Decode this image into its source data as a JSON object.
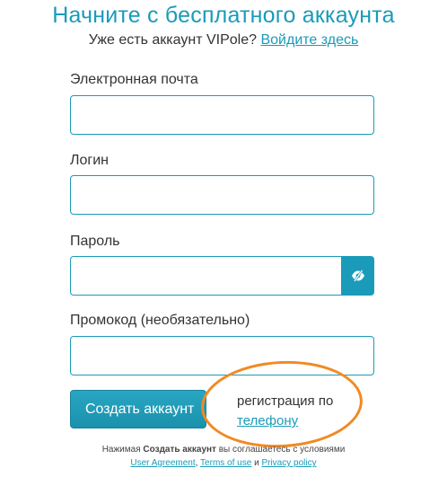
{
  "header": {
    "title": "Начните с бесплатного аккаунта",
    "login_prompt": "Уже есть аккаунт VIPole?",
    "login_link": "Войдите здесь"
  },
  "form": {
    "email_label": "Электронная почта",
    "email_value": "",
    "login_label": "Логин",
    "login_value": "",
    "password_label": "Пароль",
    "password_value": "",
    "promo_label": "Промокод (необязательно)",
    "promo_value": "",
    "create_button": "Создать аккаунт",
    "phone_text": "регистрация по",
    "phone_link": "телефону"
  },
  "legal": {
    "prefix": "Нажимая",
    "button_name": "Создать аккаунт",
    "suffix": "вы соглашаетесь с условиями",
    "user_agreement": "User Agreement",
    "comma": ",",
    "terms": "Terms of use",
    "and": "и",
    "privacy": "Privacy policy"
  },
  "icons": {
    "password_toggle": "eye-slash-icon"
  },
  "colors": {
    "accent": "#1a9bb9",
    "highlight_oval": "#f08a24"
  }
}
